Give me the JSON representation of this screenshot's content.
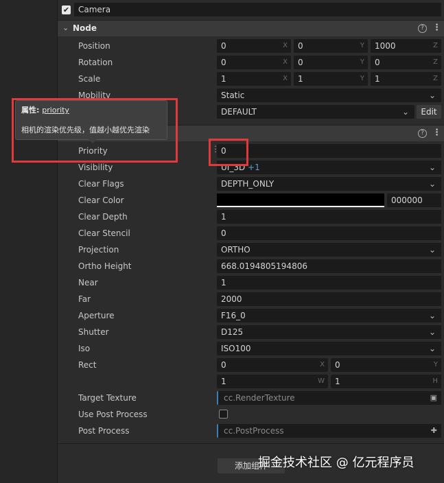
{
  "camera": {
    "label": "Camera",
    "checked": true
  },
  "node": {
    "title": "Node",
    "position": {
      "label": "Position",
      "x": "0",
      "y": "0",
      "z": "1000"
    },
    "rotation": {
      "label": "Rotation",
      "x": "0",
      "y": "0",
      "z": "0"
    },
    "scale": {
      "label": "Scale",
      "x": "1",
      "y": "1",
      "z": "1"
    },
    "mobility": {
      "label": "Mobility",
      "value": "Static"
    },
    "layer": {
      "value": "DEFAULT",
      "edit_label": "Edit"
    }
  },
  "axes": {
    "x": "X",
    "y": "Y",
    "z": "Z",
    "w": "W",
    "h": "H"
  },
  "tooltip": {
    "prefix": "属性:",
    "prop": "priority",
    "desc": "相机的渲染优先级，值越小越优先渲染"
  },
  "camera_comp": {
    "priority": {
      "label": "Priority",
      "value": "0"
    },
    "visibility": {
      "label": "Visibility",
      "value": "UI_3D",
      "extra": "+1"
    },
    "clear_flags": {
      "label": "Clear Flags",
      "value": "DEPTH_ONLY"
    },
    "clear_color": {
      "label": "Clear Color",
      "hex": "000000",
      "swatch": "#000000"
    },
    "clear_depth": {
      "label": "Clear Depth",
      "value": "1"
    },
    "clear_stencil": {
      "label": "Clear Stencil",
      "value": "0"
    },
    "projection": {
      "label": "Projection",
      "value": "ORTHO"
    },
    "ortho_height": {
      "label": "Ortho Height",
      "value": "668.0194805194806"
    },
    "near": {
      "label": "Near",
      "value": "1"
    },
    "far": {
      "label": "Far",
      "value": "2000"
    },
    "aperture": {
      "label": "Aperture",
      "value": "F16_0"
    },
    "shutter": {
      "label": "Shutter",
      "value": "D125"
    },
    "iso": {
      "label": "Iso",
      "value": "ISO100"
    },
    "rect": {
      "label": "Rect",
      "x": "0",
      "y": "0",
      "w": "1",
      "h": "1"
    },
    "target_texture": {
      "label": "Target Texture",
      "placeholder": "cc.RenderTexture"
    },
    "use_post_process": {
      "label": "Use Post Process",
      "checked": false
    },
    "post_process": {
      "label": "Post Process",
      "placeholder": "cc.PostProcess"
    }
  },
  "add_component_label": "添加组件",
  "watermark": "掘金技术社区 @ 亿元程序员",
  "colors": {
    "highlight_red": "#e03a3a",
    "asset_accent": "#3d7fb8",
    "visibility_extra": "#5a9fd6"
  },
  "icons": {
    "help": "question-circle-icon",
    "menu": "kebab-menu-icon",
    "chevron": "chevron-down-icon",
    "caret": "caret-down-icon"
  }
}
